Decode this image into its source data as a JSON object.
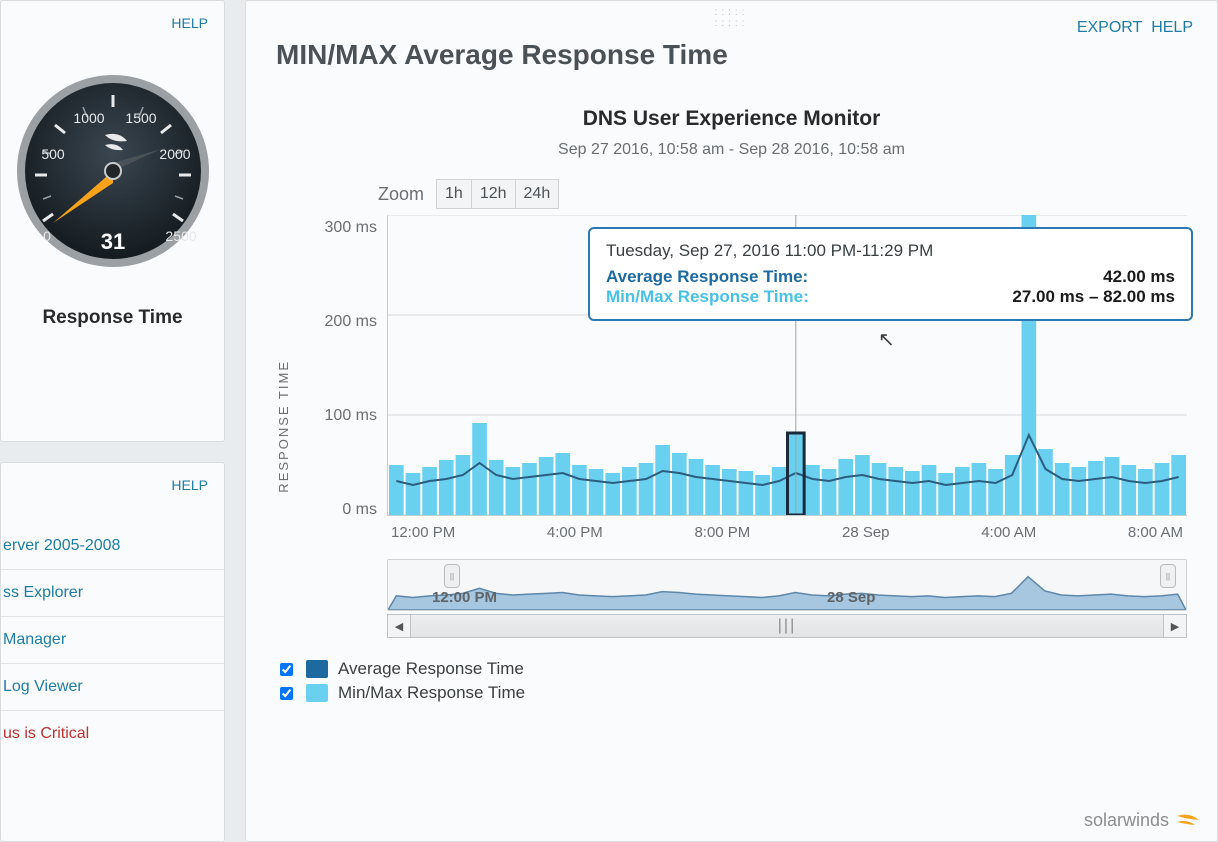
{
  "sidebar": {
    "gauge": {
      "help_label": "HELP",
      "ticks": [
        "0",
        "500",
        "1000",
        "1500",
        "2000",
        "2500"
      ],
      "value": "31",
      "caption": "Response Time"
    },
    "list": {
      "help_label": "HELP",
      "items": [
        {
          "label": "erver 2005-2008",
          "critical": false
        },
        {
          "label": "ss Explorer",
          "critical": false
        },
        {
          "label": "Manager",
          "critical": false
        },
        {
          "label": "Log Viewer",
          "critical": false
        },
        {
          "label": "us is Critical",
          "critical": true
        }
      ]
    }
  },
  "main": {
    "title": "MIN/MAX Average Response Time",
    "export_label": "EXPORT",
    "help_label": "HELP",
    "chart_title": "DNS User Experience Monitor",
    "date_range": "Sep 27 2016, 10:58 am - Sep 28 2016, 10:58 am",
    "zoom_label": "Zoom",
    "zoom_options": [
      "1h",
      "12h",
      "24h"
    ],
    "y_axis_title": "RESPONSE TIME",
    "tooltip": {
      "header": "Tuesday, Sep 27, 2016 11:00 PM-11:29 PM",
      "avg_label": "Average Response Time:",
      "avg_value": "42.00 ms",
      "mm_label": "Min/Max Response Time:",
      "mm_value": "27.00 ms – 82.00 ms"
    },
    "navigator_labels": [
      "12:00 PM",
      "28 Sep"
    ],
    "legend": {
      "avg": "Average Response Time",
      "minmax": "Min/Max Response Time"
    },
    "brand": "solarwinds"
  },
  "chart_data": {
    "type": "bar",
    "ylabel": "RESPONSE TIME",
    "ylim": [
      0,
      300
    ],
    "y_ticks": [
      "300 ms",
      "200 ms",
      "100 ms",
      "0 ms"
    ],
    "x_ticks": [
      "12:00 PM",
      "4:00 PM",
      "8:00 PM",
      "28 Sep",
      "4:00 AM",
      "8:00 AM"
    ],
    "unit": "ms",
    "selected_index": 24,
    "series": [
      {
        "name": "Min/Max Response Time",
        "role": "range-bar",
        "values": [
          50,
          42,
          48,
          55,
          60,
          92,
          55,
          48,
          52,
          58,
          62,
          50,
          46,
          42,
          48,
          52,
          70,
          62,
          56,
          50,
          46,
          44,
          40,
          48,
          82,
          50,
          46,
          56,
          60,
          52,
          48,
          44,
          50,
          42,
          48,
          52,
          46,
          60,
          310,
          66,
          52,
          48,
          54,
          58,
          50,
          46,
          52,
          60
        ]
      },
      {
        "name": "Average Response Time",
        "role": "line",
        "values": [
          34,
          30,
          34,
          36,
          40,
          52,
          40,
          36,
          38,
          40,
          42,
          36,
          34,
          32,
          34,
          36,
          44,
          42,
          38,
          36,
          34,
          32,
          30,
          34,
          42,
          36,
          34,
          38,
          40,
          36,
          34,
          32,
          34,
          30,
          32,
          34,
          32,
          40,
          80,
          46,
          36,
          34,
          36,
          38,
          34,
          32,
          34,
          38
        ]
      }
    ]
  }
}
